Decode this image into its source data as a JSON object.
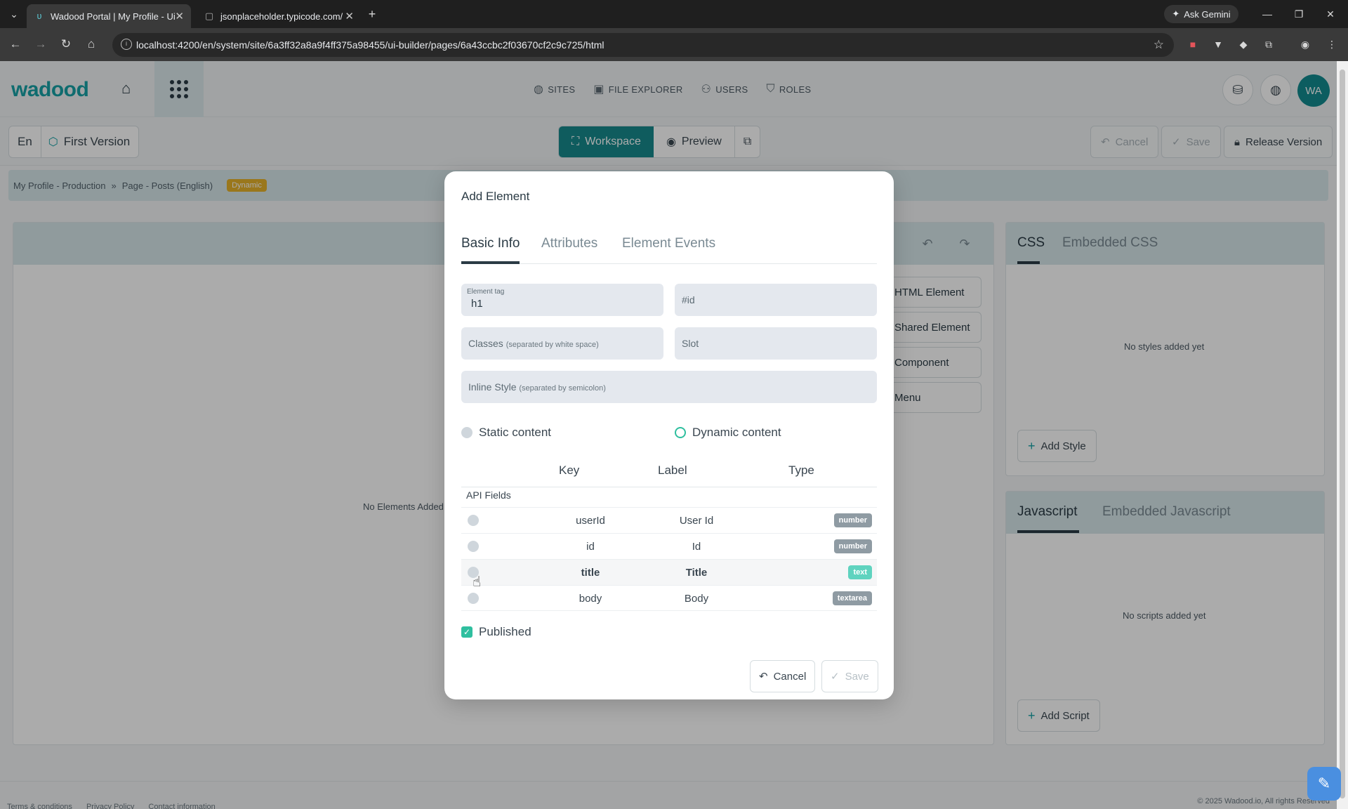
{
  "browser": {
    "tabs": [
      {
        "title": "Wadood Portal | My Profile - Ui"
      },
      {
        "title": "jsonplaceholder.typicode.com/"
      }
    ],
    "url": "localhost:4200/en/system/site/6a3ff32a8a9f4ff375a98455/ui-builder/pages/6a43ccbc2f03670cf2c9c725/html",
    "gemini_label": "Ask Gemini"
  },
  "header": {
    "logo": "wadood",
    "nav": [
      {
        "label": "SITES",
        "icon": "globe-icon"
      },
      {
        "label": "FILE EXPLORER",
        "icon": "images-icon"
      },
      {
        "label": "USERS",
        "icon": "users-icon"
      },
      {
        "label": "ROLES",
        "icon": "shield-icon"
      }
    ],
    "avatar_initials": "WA"
  },
  "toolbar": {
    "language": "En",
    "version": "First Version",
    "workspace_label": "Workspace",
    "preview_label": "Preview",
    "cancel_label": "Cancel",
    "save_label": "Save",
    "release_label": "Release Version"
  },
  "breadcrumb": {
    "items": [
      "My Profile - Production",
      "Page - Posts (English)"
    ],
    "separator": "»",
    "badge": "Dynamic"
  },
  "workspace": {
    "empty_text": "No Elements Added Y",
    "side_buttons": [
      "HTML Element",
      "Shared Element",
      "Component",
      "Menu"
    ]
  },
  "css_panel": {
    "tabs": [
      "CSS",
      "Embedded CSS"
    ],
    "empty_text": "No styles added yet",
    "add_label": "Add Style"
  },
  "js_panel": {
    "tabs": [
      "Javascript",
      "Embedded Javascript"
    ],
    "empty_text": "No scripts added yet",
    "add_label": "Add Script"
  },
  "modal": {
    "title": "Add Element",
    "tabs": [
      "Basic Info",
      "Attributes",
      "Element Events"
    ],
    "element_tag_label": "Element tag",
    "element_tag_value": "h1",
    "id_placeholder": "#id",
    "classes_placeholder": "Classes",
    "classes_hint": "(separated by white space)",
    "slot_placeholder": "Slot",
    "inline_style_placeholder": "Inline Style",
    "inline_style_hint": "(separated by semicolon)",
    "static_label": "Static content",
    "dynamic_label": "Dynamic content",
    "columns": [
      "Key",
      "Label",
      "Type"
    ],
    "group_label": "API Fields",
    "rows": [
      {
        "key": "userId",
        "label": "User Id",
        "type": "number"
      },
      {
        "key": "id",
        "label": "Id",
        "type": "number"
      },
      {
        "key": "title",
        "label": "Title",
        "type": "text"
      },
      {
        "key": "body",
        "label": "Body",
        "type": "textarea"
      }
    ],
    "published_label": "Published",
    "cancel_label": "Cancel",
    "save_label": "Save"
  },
  "footer": {
    "links": [
      "Terms & conditions",
      "Privacy Policy",
      "Contact information"
    ],
    "copyright": "© 2025 Wadood.io, All rights Reserved"
  },
  "colors": {
    "brand": "#17a2a6",
    "primary": "#17898d",
    "badge_dynamic": "#e6b22b",
    "badge_text": "#5fd3bf",
    "badge_default": "#8f9ba3"
  }
}
